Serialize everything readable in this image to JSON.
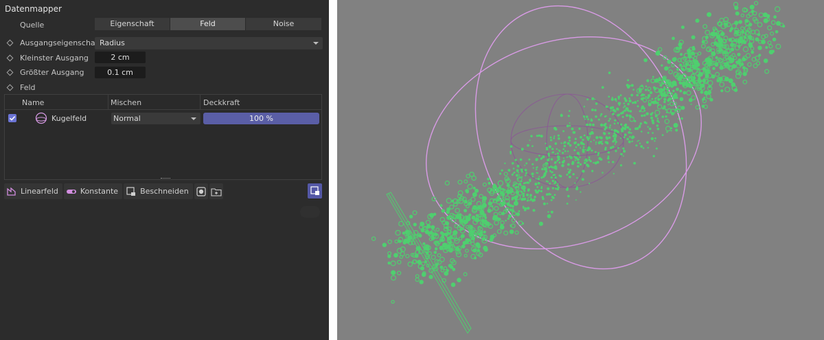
{
  "panel": {
    "title": "Datenmapper",
    "quelle_label": "Quelle",
    "source_tabs": [
      "Eigenschaft",
      "Feld",
      "Noise"
    ],
    "active_tab": "Feld",
    "ausgang_label": "Ausgangseigenschaft",
    "ausgang_value": "Radius",
    "kleinster_label": "Kleinster Ausgang",
    "kleinster_value": "2 cm",
    "groesster_label": "Größter Ausgang",
    "groesster_value": "0.1 cm",
    "feld_label": "Feld"
  },
  "fieldlist": {
    "columns": [
      "Name",
      "Mischen",
      "Deckkraft"
    ],
    "rows": [
      {
        "name": "Kugelfeld",
        "mode": "Normal",
        "opacity": "100 %",
        "enabled": true
      }
    ]
  },
  "toolbar": {
    "linear": "Linearfeld",
    "konstante": "Konstante",
    "beschneiden": "Beschneiden"
  },
  "colors": {
    "accent": "#5a5ea6",
    "particles": "#4fcf6f",
    "sphere_field": "#d99be6",
    "viewport_bg": "#818181"
  }
}
